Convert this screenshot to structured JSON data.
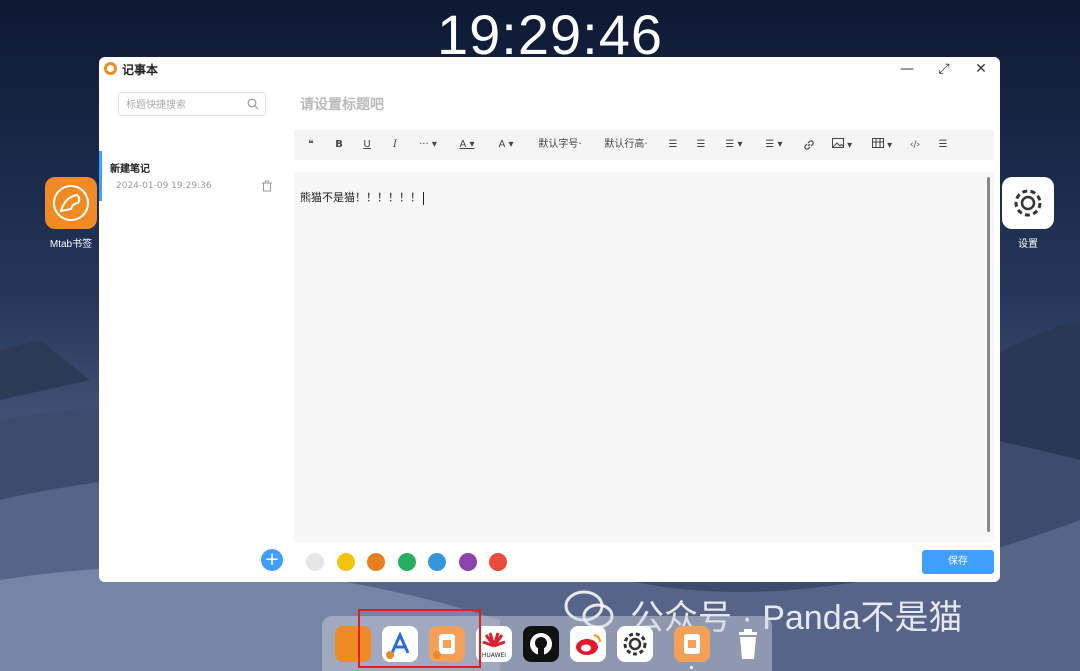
{
  "clock": "19:29:46",
  "desktop_icons": [
    {
      "label": "Mtab书签"
    },
    {
      "label": "设置"
    }
  ],
  "app": {
    "title": "记事本",
    "search_placeholder": "标题快捷搜索",
    "title_placeholder": "请设置标题吧",
    "notes": [
      {
        "title": "新建笔记",
        "date": "2024-01-09 19:29:36"
      }
    ],
    "toolbar": {
      "quote": "❝",
      "bold": "B",
      "underline": "U",
      "italic": "I",
      "more": "··· ▾",
      "font_color": "A ▾",
      "bg_color": "A ▾",
      "font_size": "默认字号·",
      "line_height": "默认行高·",
      "bullet_list": "☰",
      "ordered_list": "☰",
      "align": "☰ ▾",
      "indent": "☰ ▾",
      "link": "🔗",
      "image": "▾",
      "table": "▾",
      "code": "‹/›",
      "divider": "☰"
    },
    "content": "熊猫不是猫！！！！！！",
    "colors": [
      "#e6e6e6",
      "#f1c40f",
      "#e67e22",
      "#27ae60",
      "#3498db",
      "#8e44ad",
      "#e74c3c"
    ],
    "save_label": "保存",
    "add_label": "+"
  },
  "watermark": "公众号 · Panda不是猫",
  "dock": {
    "items": [
      "mtab",
      "app-store",
      "notepad",
      "huawei",
      "github",
      "weibo",
      "settings",
      "notepad-active",
      "trash"
    ],
    "huawei_label": "HUAWEI"
  }
}
